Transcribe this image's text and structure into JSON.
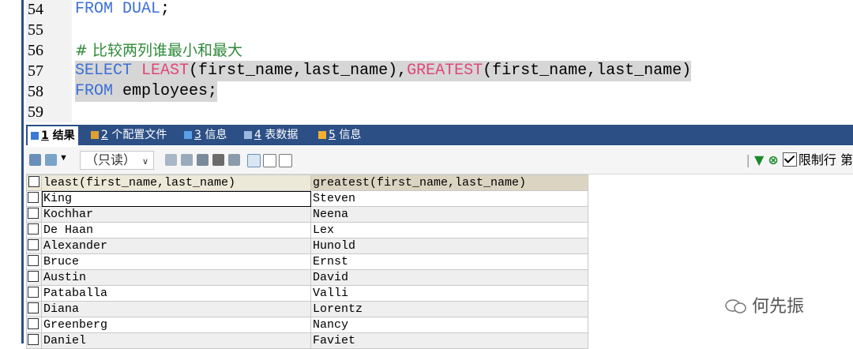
{
  "editor": {
    "lines": [
      {
        "num": "54",
        "parts": [
          {
            "cls": "kw",
            "t": "FROM DUAL"
          },
          {
            "cls": "txt",
            "t": ";"
          }
        ]
      },
      {
        "num": "55",
        "parts": []
      },
      {
        "num": "56",
        "parts": [
          {
            "cls": "cmt",
            "t": "# 比较两列谁最小和最大"
          }
        ]
      },
      {
        "num": "57",
        "parts": [
          {
            "cls": "kw",
            "t": "SELECT "
          },
          {
            "cls": "fn",
            "t": "LEAST"
          },
          {
            "cls": "txt",
            "t": "(first_name,last_name),"
          },
          {
            "cls": "fn",
            "t": "GREATEST"
          },
          {
            "cls": "txt",
            "t": "(first_name,last_name)"
          }
        ],
        "selected": true
      },
      {
        "num": "58",
        "parts": [
          {
            "cls": "kw",
            "t": "FROM "
          },
          {
            "cls": "txt",
            "t": "employees;"
          }
        ],
        "selected": true
      },
      {
        "num": "59",
        "parts": []
      }
    ]
  },
  "tabs": [
    {
      "num": "1",
      "label": " 结果",
      "active": true,
      "icon_color": "#3a7bd5"
    },
    {
      "num": "2",
      "label": " 个配置文件",
      "active": false,
      "icon_color": "#e0a030"
    },
    {
      "num": "3",
      "label": " 信息",
      "active": false,
      "icon_color": "#5aa0e8"
    },
    {
      "num": "4",
      "label": " 表数据",
      "active": false,
      "icon_color": "#9db8e0"
    },
    {
      "num": "5",
      "label": " 信息",
      "active": false,
      "icon_color": "#f0b030"
    }
  ],
  "toolbar": {
    "mode_label": "（只读）",
    "limit_label": "限制行 第"
  },
  "grid": {
    "columns": [
      "least(first_name,last_name)",
      "greatest(first_name,last_name)"
    ],
    "rows": [
      [
        "King",
        "Steven"
      ],
      [
        "Kochhar",
        "Neena"
      ],
      [
        "De Haan",
        "Lex"
      ],
      [
        "Alexander",
        "Hunold"
      ],
      [
        "Bruce",
        "Ernst"
      ],
      [
        "Austin",
        "David"
      ],
      [
        "Pataballa",
        "Valli"
      ],
      [
        "Diana",
        "Lorentz"
      ],
      [
        "Greenberg",
        "Nancy"
      ],
      [
        "Daniel",
        "Faviet"
      ]
    ]
  },
  "watermark": {
    "text": "何先振"
  },
  "colors": {
    "accent": "#2c4f86",
    "keyword": "#3b6fd8",
    "function": "#e1457a",
    "comment": "#2f8a3a"
  }
}
